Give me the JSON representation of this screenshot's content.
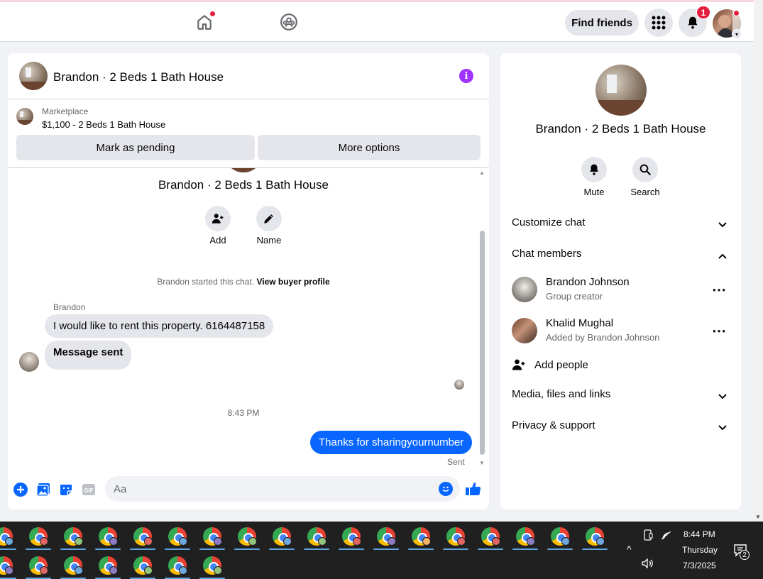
{
  "nav": {
    "find_friends": "Find friends",
    "notification_count": "1"
  },
  "chat": {
    "title": "Brandon · 2 Beds 1 Bath House",
    "marketplace_label": "Marketplace",
    "listing": "$1,100 - 2 Beds 1 Bath House",
    "mark_pending": "Mark as pending",
    "more_options": "More options",
    "conversation_name": "Brandon · 2 Beds 1 Bath House",
    "add_label": "Add",
    "name_label": "Name",
    "started_text": "Brandon started this chat.",
    "view_buyer_profile": "View buyer profile",
    "sender_name": "Brandon",
    "msg1": "I would like to rent this property. 6164487158",
    "msg2": "Message sent",
    "timestamp": "8:43 PM",
    "outgoing": "Thanks for sharingyournumber",
    "sent_status": "Sent",
    "input_placeholder": "Aa"
  },
  "side": {
    "title": "Brandon · 2 Beds 1 Bath House",
    "mute": "Mute",
    "search": "Search",
    "customize_chat": "Customize chat",
    "chat_members": "Chat members",
    "members": [
      {
        "name": "Brandon Johnson",
        "sub": "Group creator"
      },
      {
        "name": "Khalid Mughal",
        "sub": "Added by Brandon Johnson"
      }
    ],
    "add_people": "Add people",
    "media_files": "Media, files and links",
    "privacy_support": "Privacy & support"
  },
  "taskbar": {
    "time": "8:44 PM",
    "day": "Thursday",
    "date": "7/3/2025",
    "notification_count": "2"
  },
  "colors": {
    "accent": "#0866ff",
    "info": "#a033ff",
    "badge": "#e41e3f"
  }
}
